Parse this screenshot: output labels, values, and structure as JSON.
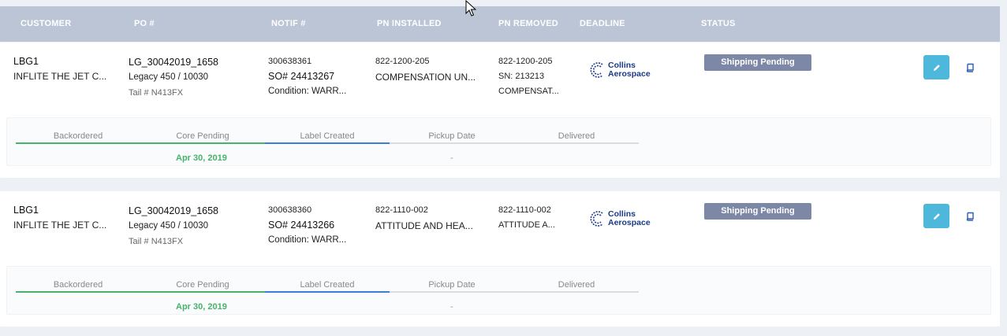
{
  "header": {
    "customer": "CUSTOMER",
    "po": "PO #",
    "notif": "NOTIF #",
    "pn_installed": "PN INSTALLED",
    "pn_removed": "PN REMOVED",
    "deadline": "DEADLINE",
    "status": "STATUS"
  },
  "rows": [
    {
      "customer_code": "LBG1",
      "customer_name": "INFLITE THE JET C...",
      "po_number": "LG_30042019_1658",
      "aircraft": "Legacy 450 / 10030",
      "tail": "Tail # N413FX",
      "notif_number": "300638361",
      "so_number": "SO# 24413267",
      "condition": "Condition: WARR...",
      "pn_installed": "822-1200-205",
      "pn_installed_desc": "COMPENSATION UN...",
      "pn_removed": "822-1200-205",
      "pn_removed_sn": "SN: 213213",
      "pn_removed_desc": "COMPENSAT...",
      "logo_line1": "Collins",
      "logo_line2": "Aerospace",
      "status": "Shipping Pending",
      "steps": [
        "Backordered",
        "Core Pending",
        "Label Created",
        "Pickup Date",
        "Delivered"
      ],
      "core_pending_date": "Apr 30, 2019",
      "pickup_date": "-"
    },
    {
      "customer_code": "LBG1",
      "customer_name": "INFLITE THE JET C...",
      "po_number": "LG_30042019_1658",
      "aircraft": "Legacy 450 / 10030",
      "tail": "Tail # N413FX",
      "notif_number": "300638360",
      "so_number": "SO# 24413266",
      "condition": "Condition: WARR...",
      "pn_installed": "822-1110-002",
      "pn_installed_desc": "ATTITUDE AND HEA...",
      "pn_removed": "822-1110-002",
      "pn_removed_sn": "",
      "pn_removed_desc": "ATTITUDE A...",
      "logo_line1": "Collins",
      "logo_line2": "Aerospace",
      "status": "Shipping Pending",
      "steps": [
        "Backordered",
        "Core Pending",
        "Label Created",
        "Pickup Date",
        "Delivered"
      ],
      "core_pending_date": "Apr 30, 2019",
      "pickup_date": "-"
    }
  ],
  "colors": {
    "header_bg": "#bcc5d6",
    "badge_bg": "#7c88a6",
    "edit_button_bg": "#4db8dc",
    "progress_complete": "#45b36b",
    "progress_active": "#3b7dd8",
    "progress_pending": "#d8dce3",
    "logo_blue": "#1a3a8a"
  }
}
